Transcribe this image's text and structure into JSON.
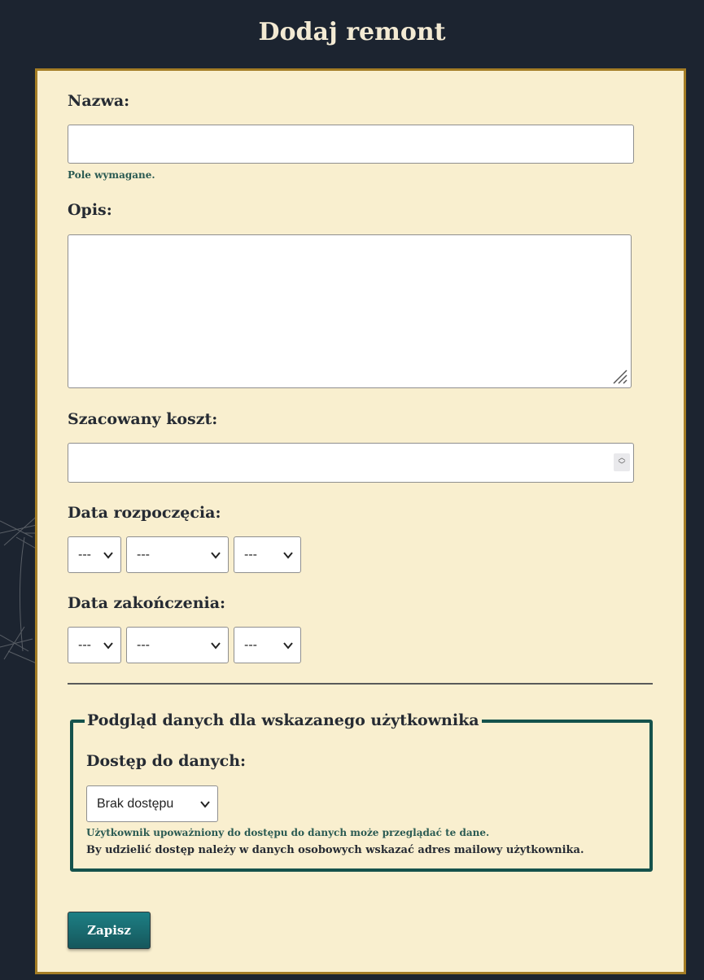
{
  "page": {
    "title": "Dodaj remont"
  },
  "form": {
    "name": {
      "label": "Nazwa:",
      "value": "",
      "help": "Pole wymagane."
    },
    "description": {
      "label": "Opis:",
      "value": ""
    },
    "cost": {
      "label": "Szacowany koszt:",
      "value": ""
    },
    "start_date": {
      "label": "Data rozpoczęcia:",
      "day": "---",
      "month": "---",
      "year": "---"
    },
    "end_date": {
      "label": "Data zakończenia:",
      "day": "---",
      "month": "---",
      "year": "---"
    },
    "sharing": {
      "legend": "Podgląd danych dla wskazanego użytkownika",
      "access_label": "Dostęp do danych:",
      "access_value": "Brak dostępu",
      "help": "Użytkownik upoważniony do dostępu do danych może przeglądać te dane.",
      "note": "By udzielić dostęp należy w danych osobowych wskazać adres mailowy użytkownika."
    },
    "submit_label": "Zapisz"
  },
  "colors": {
    "background": "#1c2430",
    "card": "#f9efcf",
    "card_border": "#a47d25",
    "accent": "#15524c",
    "button": "#1d7f84"
  }
}
